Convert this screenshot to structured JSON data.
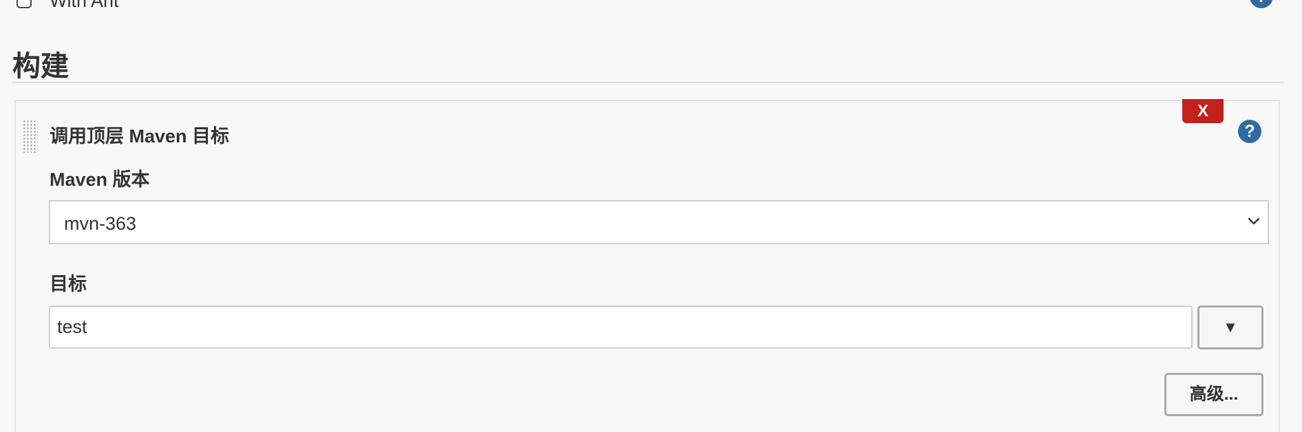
{
  "top_option": {
    "label": "With Ant",
    "checked": false,
    "help_icon": "?"
  },
  "section": {
    "title": "构建"
  },
  "build_step": {
    "title": "调用顶层 Maven 目标",
    "delete_label": "X",
    "help_icon": "?",
    "maven_version": {
      "label": "Maven 版本",
      "selected": "mvn-363"
    },
    "goals": {
      "label": "目标",
      "value": "test",
      "dropdown_label": "▼"
    },
    "advanced_label": "高级..."
  },
  "colors": {
    "help_icon": "#2f6aa3",
    "delete_button": "#c4201c",
    "background": "#f8f8f8"
  },
  "icons": {
    "help": "question-circle-icon",
    "drag": "drag-handle-icon",
    "chevron": "chevron-down-icon"
  }
}
